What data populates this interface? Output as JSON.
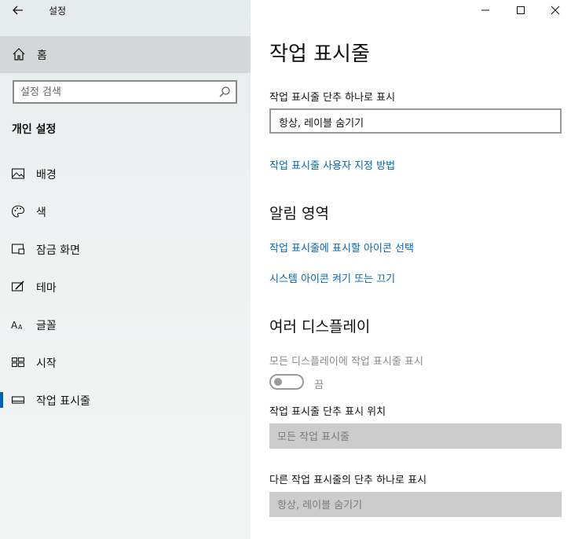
{
  "window": {
    "title": "설정"
  },
  "sidebar": {
    "home_label": "홈",
    "search_placeholder": "설정 검색",
    "section_heading": "개인 설정",
    "items": [
      {
        "label": "배경",
        "icon": "picture-icon"
      },
      {
        "label": "색",
        "icon": "palette-icon"
      },
      {
        "label": "잠금 화면",
        "icon": "lock-screen-icon"
      },
      {
        "label": "테마",
        "icon": "theme-icon"
      },
      {
        "label": "글꼴",
        "icon": "font-icon"
      },
      {
        "label": "시작",
        "icon": "start-icon"
      },
      {
        "label": "작업 표시줄",
        "icon": "taskbar-icon",
        "active": true
      }
    ]
  },
  "main": {
    "title": "작업 표시줄",
    "combine_label": "작업 표시줄 단추 하나로 표시",
    "combine_value": "항상, 레이블 숨기기",
    "customize_link": "작업 표시줄 사용자 지정 방법",
    "notification_heading": "알림 영역",
    "select_icons_link": "작업 표시줄에 표시할 아이콘 선택",
    "system_icons_link": "시스템 아이콘 켜기 또는 끄기",
    "multi_display_heading": "여러 디스플레이",
    "show_all_displays_label": "모든 디스플레이에 작업 표시줄 표시",
    "toggle_state_label": "끔",
    "button_position_label": "작업 표시줄 단추 표시 위치",
    "button_position_value": "모든 작업 표시줄",
    "other_combine_label": "다른 작업 표시줄의 단추 하나로 표시",
    "other_combine_value": "항상, 레이블 숨기기"
  },
  "colors": {
    "accent": "#0063b1",
    "link": "#0067b8",
    "sidebar_bg": "#e6ebeb",
    "disabled_field": "#cccccc"
  }
}
